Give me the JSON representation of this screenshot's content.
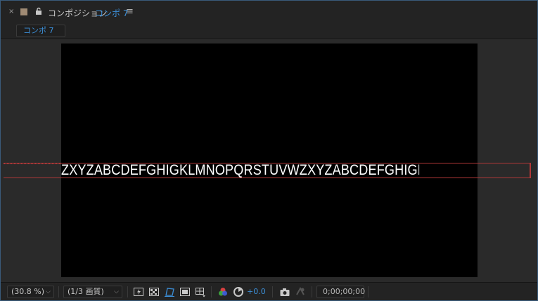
{
  "header": {
    "close_glyph": "×",
    "title": "コンポジション",
    "comp_name": "コンポ 7",
    "menu_glyph": "≡"
  },
  "tabs": [
    {
      "label": "コンポ 7"
    }
  ],
  "canvas": {
    "layer_text": "ZXYZABCDEFGHIGKLMNOPQRSTUVWZXYZABCDEFGHIGKLMNOPQRSTU"
  },
  "toolbar": {
    "zoom": "(30.8 %)",
    "resolution": "(1/3 画質)",
    "exposure": "+0.0",
    "timecode": "0;00;00;00"
  },
  "colors": {
    "accent": "#3c8fd8",
    "text_box": "#b03838",
    "panel_border": "#3a5a7a"
  }
}
